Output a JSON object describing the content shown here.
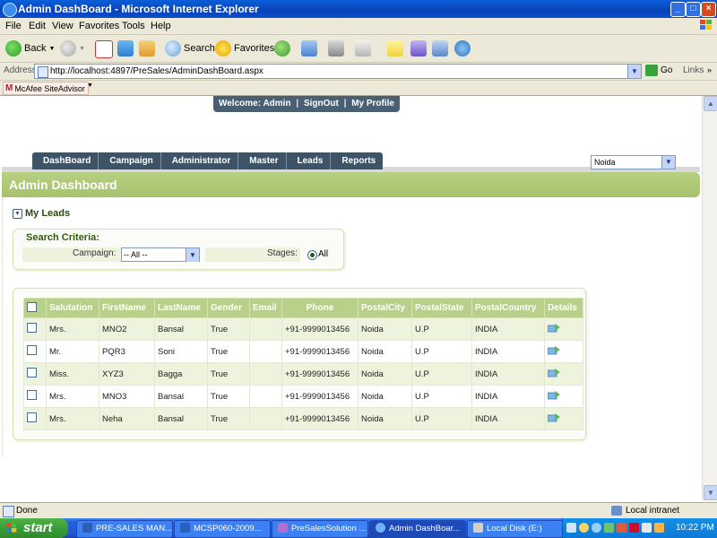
{
  "window": {
    "title": "Admin DashBoard - Microsoft Internet Explorer"
  },
  "menu": [
    "File",
    "Edit",
    "View",
    "Favorites",
    "Tools",
    "Help"
  ],
  "toolbar": {
    "back": "Back",
    "search": "Search",
    "favorites": "Favorites"
  },
  "address": {
    "label": "Address",
    "url": "http://localhost:4897/PreSales/AdminDashBoard.aspx",
    "go": "Go",
    "links": "Links"
  },
  "mcafee": {
    "label": "McAfee SiteAdvisor"
  },
  "page": {
    "welcome": {
      "prefix": "Welcome: Admin",
      "signout": "SignOut",
      "profile": "My Profile",
      "sep": "|"
    },
    "nav": [
      "DashBoard",
      "Campaign",
      "Administrator",
      "Master",
      "Leads",
      "Reports"
    ],
    "city": "Noida",
    "header": "Admin Dashboard",
    "my_leads": "My Leads",
    "search": {
      "legend": "Search Criteria:",
      "campaign_label": "Campaign:",
      "campaign_value": "-- All --",
      "stages_label": "Stages:",
      "stages_option": "All"
    },
    "grid": {
      "columns": [
        "Salutation",
        "FirstName",
        "LastName",
        "Gender",
        "Email",
        "Phone",
        "PostalCity",
        "PostalState",
        "PostalCountry",
        "Details"
      ],
      "rows": [
        [
          "Mrs.",
          "MNO2",
          "Bansal",
          "True",
          "",
          "+91-9999013456",
          "Noida",
          "U.P",
          "INDIA"
        ],
        [
          "Mr.",
          "PQR3",
          "Soni",
          "True",
          "",
          "+91-9999013456",
          "Noida",
          "U.P",
          "INDIA"
        ],
        [
          "Miss.",
          "XYZ3",
          "Bagga",
          "True",
          "",
          "+91-9999013456",
          "Noida",
          "U.P",
          "INDIA"
        ],
        [
          "Mrs.",
          "MNO3",
          "Bansal",
          "True",
          "",
          "+91-9999013456",
          "Noida",
          "U.P",
          "INDIA"
        ],
        [
          "Mrs.",
          "Neha",
          "Bansal",
          "True",
          "",
          "+91-9999013456",
          "Noida",
          "U.P",
          "INDIA"
        ]
      ]
    }
  },
  "status": {
    "left": "Done",
    "zone": "Local intranet"
  },
  "taskbar": {
    "start": "start",
    "tasks": [
      "PRE-SALES MAN...",
      "MCSP060-2009...",
      "PreSalesSolution ...",
      "Admin DashBoar...",
      "Local Disk (E:)"
    ],
    "clock": "10:22 PM"
  },
  "colors": {
    "accent_green": "#a7c26b",
    "nav_dark": "#3e5366",
    "xp_blue": "#245edb"
  }
}
